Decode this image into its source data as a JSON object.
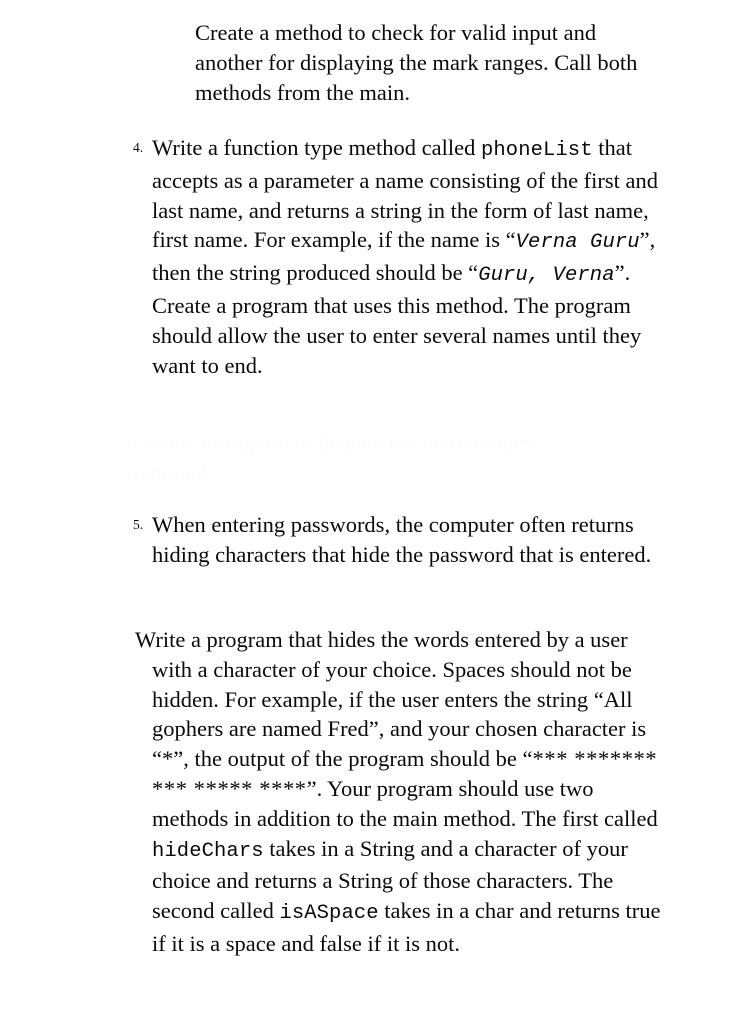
{
  "document": {
    "type": "assignment-questions-page",
    "background_color": "#ffffff",
    "text_color": "#0a0a0a",
    "ghost_text_color": "#fcfcfd"
  },
  "continued_paragraph": {
    "text": "Create a method to check for valid input and another for displaying the mark ranges. Call both methods from the main."
  },
  "question_4": {
    "number": "4.",
    "segment_1": "Write a function type method called ",
    "code_1": "phoneList",
    "segment_2": " that accepts as a parameter a name consisting of the first and last name, and returns a string in the form of last name, first name. For example, if the name is “",
    "code_2": "Verna Guru",
    "segment_3": "”, then the string produced should be “",
    "code_3": "Guru, Verna",
    "segment_4": "”. Create a program that uses this method. The program should allow the user to enter several names until they want to end."
  },
  "ghost_block": {
    "line_1": "Create a program to display the mark ranges",
    "line_2": "required."
  },
  "question_5": {
    "number": "5.",
    "text": "When entering passwords, the computer often returns hiding characters that hide the password that is entered."
  },
  "question_5_body": {
    "segment_1": "Write a program that hides the words entered by a user with a character of your choice. Spaces should not be hidden. For example, if the user enters the string “All gophers are named Fred”, and your chosen character is “*”, the output of the program should be “",
    "stars": "*** ******* *** ***** ****",
    "segment_2": "”. Your program should use two methods in addition to the main method. The first called ",
    "code_1": "hideChars",
    "segment_3": " takes in a String and a character of your choice and returns a String of those characters. The second called ",
    "code_2": "isASpace",
    "segment_4": " takes in a char and returns true if it is a space and false if it is not."
  }
}
